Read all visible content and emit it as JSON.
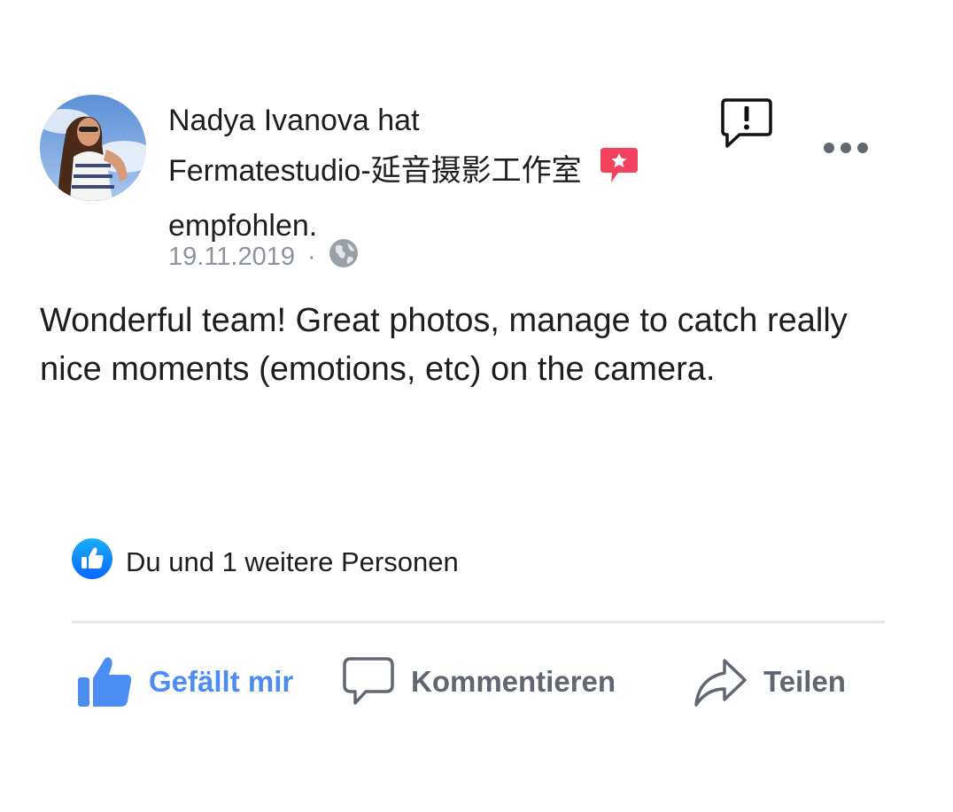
{
  "post": {
    "author_line": "Nadya Ivanova hat",
    "page_line": "Fermatestudio-延音摄影工作室",
    "verb_line": "empfohlen.",
    "date": "19.11.2019",
    "separator": "·",
    "privacy_icon": "globe-icon",
    "body": "Wonderful team! Great photos, manage to catch really nice moments (emotions, etc) on the camera."
  },
  "header_actions": {
    "report_icon": "report-speech-bubble-icon",
    "more_icon": "ellipsis-icon"
  },
  "reactions": {
    "icon": "thumbs-up-icon",
    "summary": "Du und 1 weitere Personen"
  },
  "actions": {
    "like_label": "Gefällt mir",
    "comment_label": "Kommentieren",
    "share_label": "Teilen"
  },
  "colors": {
    "accent_blue": "#4b8df2",
    "recommend_badge": "#f3425f",
    "muted_text": "#8d949e",
    "action_gray": "#606770"
  }
}
